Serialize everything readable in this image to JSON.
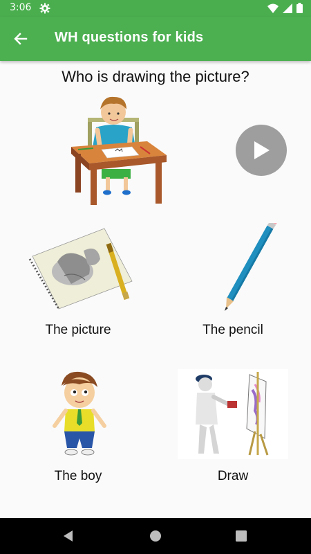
{
  "status_bar": {
    "time": "3:06",
    "icons": [
      "gear-icon",
      "wifi-icon",
      "signal-icon",
      "battery-icon"
    ]
  },
  "app_bar": {
    "title": "WH questions for kids",
    "back_icon": "arrow-back-icon",
    "color": "#4caf50"
  },
  "question": "Who is drawing the picture?",
  "play_button": {
    "icon": "play-icon",
    "color": "#9e9e9e"
  },
  "options": [
    {
      "label": "The picture",
      "icon": "sketchbook-image"
    },
    {
      "label": "The pencil",
      "icon": "pencil-image"
    },
    {
      "label": "The boy",
      "icon": "boy-image"
    },
    {
      "label": "Draw",
      "icon": "painter-image"
    }
  ],
  "nav_bar": {
    "buttons": [
      "back-triangle-icon",
      "home-circle-icon",
      "recents-square-icon"
    ]
  }
}
